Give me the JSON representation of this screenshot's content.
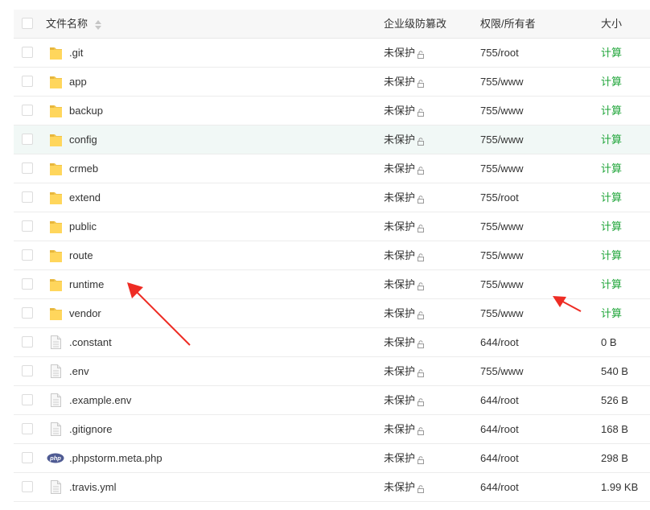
{
  "header": {
    "name": "文件名称",
    "protection": "企业级防篡改",
    "permission": "权限/所有者",
    "size": "大小"
  },
  "rows": [
    {
      "name": ".git",
      "type": "folder",
      "protection": "未保护",
      "permission": "755/root",
      "size": "计算",
      "size_is_action": true
    },
    {
      "name": "app",
      "type": "folder",
      "protection": "未保护",
      "permission": "755/www",
      "size": "计算",
      "size_is_action": true
    },
    {
      "name": "backup",
      "type": "folder",
      "protection": "未保护",
      "permission": "755/www",
      "size": "计算",
      "size_is_action": true
    },
    {
      "name": "config",
      "type": "folder",
      "protection": "未保护",
      "permission": "755/www",
      "size": "计算",
      "size_is_action": true
    },
    {
      "name": "crmeb",
      "type": "folder",
      "protection": "未保护",
      "permission": "755/www",
      "size": "计算",
      "size_is_action": true
    },
    {
      "name": "extend",
      "type": "folder",
      "protection": "未保护",
      "permission": "755/root",
      "size": "计算",
      "size_is_action": true
    },
    {
      "name": "public",
      "type": "folder",
      "protection": "未保护",
      "permission": "755/www",
      "size": "计算",
      "size_is_action": true
    },
    {
      "name": "route",
      "type": "folder",
      "protection": "未保护",
      "permission": "755/www",
      "size": "计算",
      "size_is_action": true
    },
    {
      "name": "runtime",
      "type": "folder",
      "protection": "未保护",
      "permission": "755/www",
      "size": "计算",
      "size_is_action": true
    },
    {
      "name": "vendor",
      "type": "folder",
      "protection": "未保护",
      "permission": "755/www",
      "size": "计算",
      "size_is_action": true
    },
    {
      "name": ".constant",
      "type": "file",
      "protection": "未保护",
      "permission": "644/root",
      "size": "0 B",
      "size_is_action": false
    },
    {
      "name": ".env",
      "type": "file",
      "protection": "未保护",
      "permission": "755/www",
      "size": "540 B",
      "size_is_action": false
    },
    {
      "name": ".example.env",
      "type": "file",
      "protection": "未保护",
      "permission": "644/root",
      "size": "526 B",
      "size_is_action": false
    },
    {
      "name": ".gitignore",
      "type": "file",
      "protection": "未保护",
      "permission": "644/root",
      "size": "168 B",
      "size_is_action": false
    },
    {
      "name": ".phpstorm.meta.php",
      "type": "php",
      "protection": "未保护",
      "permission": "644/root",
      "size": "298 B",
      "size_is_action": false
    },
    {
      "name": ".travis.yml",
      "type": "file",
      "protection": "未保护",
      "permission": "644/root",
      "size": "1.99 KB",
      "size_is_action": false
    }
  ],
  "icon_badge_text": "php",
  "colors": {
    "accent_green": "#20a53a",
    "hover_row": "#f1f8f6",
    "header_bg": "#f7f7f7",
    "annotation_red": "#ee2c24"
  }
}
